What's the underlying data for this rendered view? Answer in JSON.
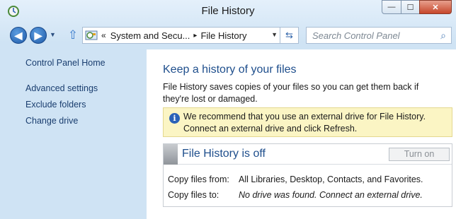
{
  "window": {
    "title": "File History",
    "controls": {
      "minimize": "—",
      "maximize": "☐",
      "close": "✕"
    }
  },
  "nav": {
    "back_icon": "back-arrow-icon",
    "forward_icon": "forward-arrow-icon",
    "breadcrumb": {
      "prefix": "«",
      "items": [
        "System and Secu...",
        "File History"
      ],
      "separator": "▸"
    },
    "search": {
      "placeholder": "Search Control Panel"
    }
  },
  "sidebar": {
    "items": [
      {
        "label": "Control Panel Home"
      },
      {
        "label": "Advanced settings"
      },
      {
        "label": "Exclude folders"
      },
      {
        "label": "Change drive"
      }
    ]
  },
  "main": {
    "heading": "Keep a history of your files",
    "description": "File History saves copies of your files so you can get them back if they're lost or damaged.",
    "info": {
      "line1": "We recommend that you use an external drive for File History.",
      "line2": "Connect an external drive and click Refresh."
    },
    "status": {
      "title": "File History is off",
      "button": "Turn on",
      "rows": [
        {
          "label": "Copy files from:",
          "value": "All Libraries, Desktop, Contacts, and Favorites."
        },
        {
          "label": "Copy files to:",
          "value": "No drive was found. Connect an external drive."
        }
      ]
    }
  },
  "colors": {
    "link": "#1a3e6f",
    "heading": "#1e4e8c",
    "info_background": "#fbf5c4",
    "close_button": "#c6472b"
  }
}
